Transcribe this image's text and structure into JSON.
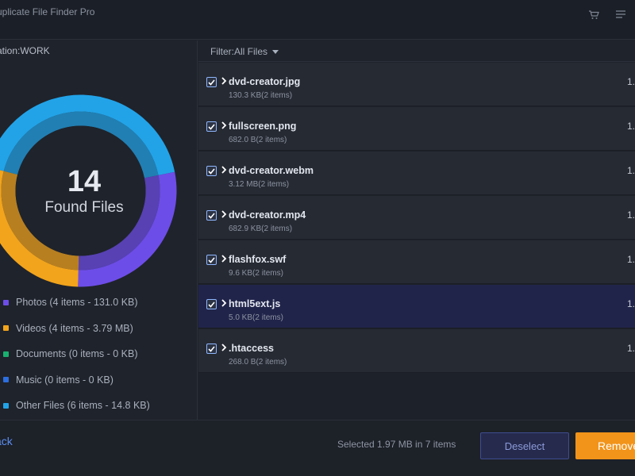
{
  "app": {
    "title": "uplicate File Finder Pro"
  },
  "titlebar": {
    "icons": [
      "cart-icon",
      "menu-icon"
    ]
  },
  "left": {
    "location": "ation:WORK",
    "summary": {
      "count": "14",
      "label": "Found Files"
    },
    "legend": [
      {
        "label": "Photos (4 items - 131.0 KB)",
        "color": "#6d4de8"
      },
      {
        "label": "Videos (4 items - 3.79 MB)",
        "color": "#f2a41c"
      },
      {
        "label": "Documents (0 items - 0 KB)",
        "color": "#19b070"
      },
      {
        "label": "Music (0 items - 0 KB)",
        "color": "#2d6ee0"
      },
      {
        "label": "Other Files (6 items - 14.8 KB)",
        "color": "#22a3e8"
      }
    ]
  },
  "donut": {
    "segments": [
      {
        "name": "Other Files",
        "value": 6,
        "color": "#22a3e8"
      },
      {
        "name": "Photos",
        "value": 4,
        "color": "#6d4de8"
      },
      {
        "name": "Videos",
        "value": 4,
        "color": "#f2a41c"
      }
    ]
  },
  "filter": {
    "label": "Filter:All Files"
  },
  "files": [
    {
      "name": "dvd-creator.jpg",
      "meta": "130.3 KB(2 items)",
      "right": "1.",
      "selected": false
    },
    {
      "name": "fullscreen.png",
      "meta": "682.0 B(2 items)",
      "right": "1.",
      "selected": false
    },
    {
      "name": "dvd-creator.webm",
      "meta": "3.12 MB(2 items)",
      "right": "1.",
      "selected": false
    },
    {
      "name": "dvd-creator.mp4",
      "meta": "682.9 KB(2 items)",
      "right": "1.",
      "selected": false
    },
    {
      "name": "flashfox.swf",
      "meta": "9.6 KB(2 items)",
      "right": "1.",
      "selected": false
    },
    {
      "name": "html5ext.js",
      "meta": "5.0 KB(2 items)",
      "right": "1.",
      "selected": true
    },
    {
      "name": ".htaccess",
      "meta": "268.0 B(2 items)",
      "right": "1.",
      "selected": false
    }
  ],
  "bottom": {
    "back": "ack",
    "selected_summary": "Selected 1.97 MB in 7 items",
    "deselect": "Deselect",
    "remove": "Remove"
  }
}
